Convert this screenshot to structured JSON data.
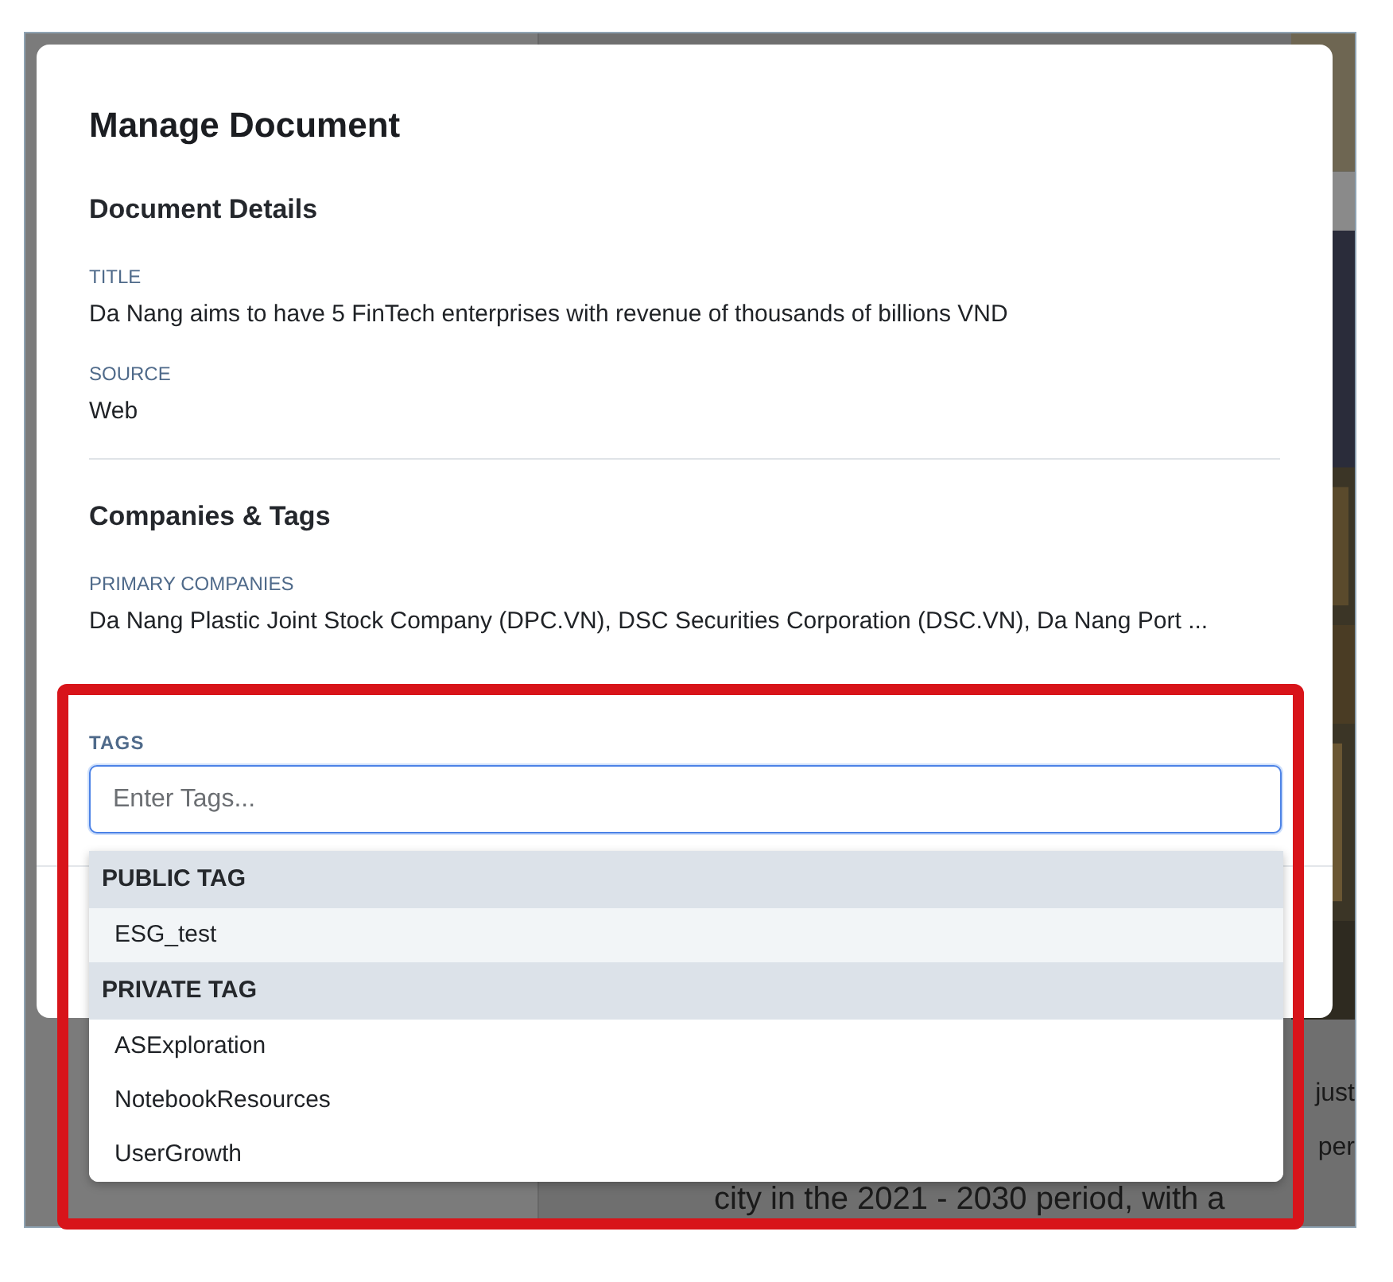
{
  "background": {
    "text_lines": [
      "just",
      "per",
      "city in the 2021 - 2030 period, with a"
    ]
  },
  "dialog": {
    "title": "Manage Document",
    "sections": [
      {
        "heading": "Document Details",
        "fields": [
          {
            "label": "TITLE",
            "value": "Da Nang aims to have 5 FinTech enterprises with revenue of thousands of billions VND"
          },
          {
            "label": "SOURCE",
            "value": "Web"
          }
        ]
      },
      {
        "heading": "Companies & Tags",
        "fields": [
          {
            "label": "PRIMARY COMPANIES",
            "value": "Da Nang Plastic Joint Stock Company (DPC.VN), DSC Securities Corporation (DSC.VN), Da Nang Port ..."
          }
        ]
      }
    ],
    "tags_field": {
      "label": "TAGS",
      "placeholder": "Enter Tags...",
      "focused": true
    },
    "tag_dropdown": {
      "groups": [
        {
          "heading": "PUBLIC TAG",
          "items": [
            {
              "label": "ESG_test",
              "selected": true
            }
          ]
        },
        {
          "heading": "PRIVATE TAG",
          "items": [
            {
              "label": "ASExploration",
              "selected": false
            },
            {
              "label": "NotebookResources",
              "selected": false
            },
            {
              "label": "UserGrowth",
              "selected": false
            }
          ]
        }
      ]
    }
  },
  "highlight_frame": true
}
